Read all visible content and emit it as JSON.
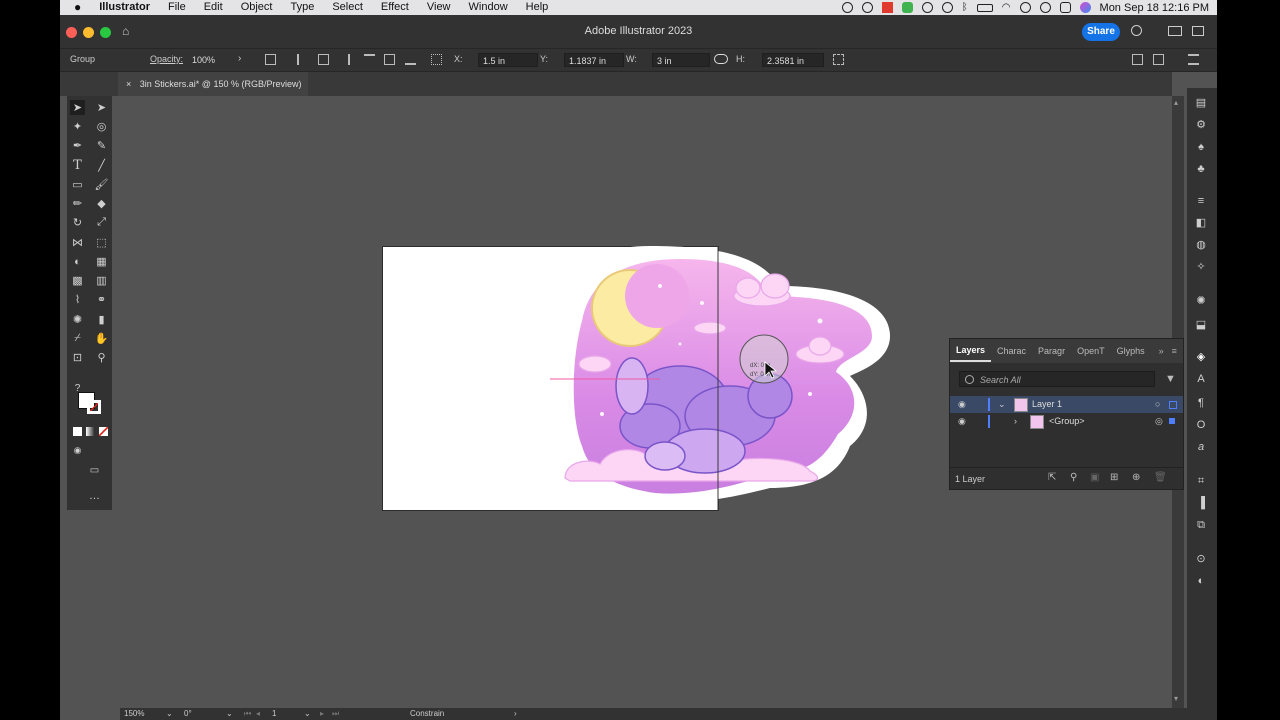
{
  "menubar": {
    "apple": "",
    "app": "Illustrator",
    "items": [
      "File",
      "Edit",
      "Object",
      "Type",
      "Select",
      "Effect",
      "View",
      "Window",
      "Help"
    ],
    "datetime": "Mon Sep 18  12:16 PM"
  },
  "window": {
    "title": "Adobe Illustrator 2023",
    "share": "Share"
  },
  "control": {
    "selection": "Group",
    "opacity_label": "Opacity:",
    "opacity": "100%",
    "x_label": "X:",
    "x": "1.5 in",
    "y_label": "Y:",
    "y": "1.1837 in",
    "w_label": "W:",
    "w": "3 in",
    "h_label": "H:",
    "h": "2.3581 in"
  },
  "doc_tab": {
    "close": "×",
    "title": "3in Stickers.ai* @ 150 % (RGB/Preview)"
  },
  "cursor_tooltip": {
    "dx": "dX: 0 in",
    "dy": "dY: 0 in"
  },
  "layers_panel": {
    "tabs": [
      "Layers",
      "Charac",
      "Paragr",
      "OpenT",
      "Glyphs"
    ],
    "search_placeholder": "Search All",
    "rows": [
      {
        "name": "Layer 1"
      },
      {
        "name": "<Group>"
      }
    ],
    "footer": "1 Layer"
  },
  "status": {
    "zoom": "150%",
    "angle": "0°",
    "artboard": "1",
    "mode": "Constrain"
  },
  "colors": {
    "accent": "#1473e6",
    "panel": "#323232",
    "canvas": "#535353"
  }
}
